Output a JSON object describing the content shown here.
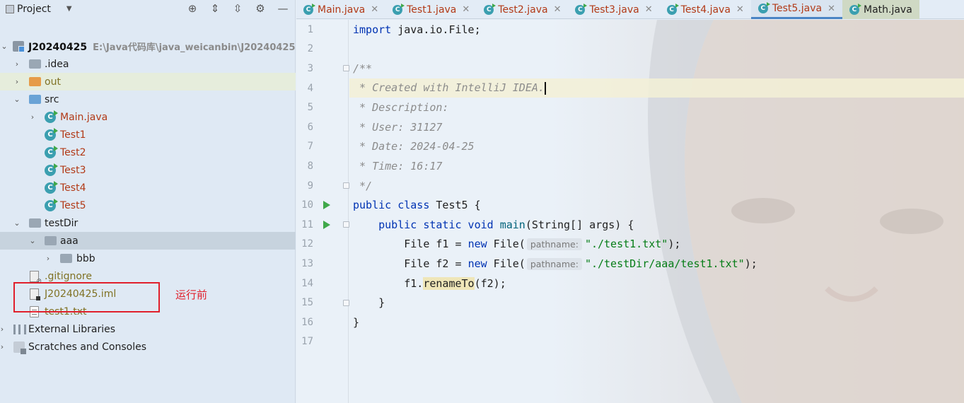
{
  "project_panel": {
    "title": "Project",
    "root": {
      "name": "J20240425",
      "path": "E:\\Java代码库\\java_weicanbin\\J20240425"
    },
    "items": [
      {
        "name": ".idea"
      },
      {
        "name": "out"
      },
      {
        "name": "src"
      },
      {
        "name": "Main.java"
      },
      {
        "name": "Test1"
      },
      {
        "name": "Test2"
      },
      {
        "name": "Test3"
      },
      {
        "name": "Test4"
      },
      {
        "name": "Test5"
      },
      {
        "name": "testDir"
      },
      {
        "name": "aaa"
      },
      {
        "name": "bbb"
      },
      {
        "name": ".gitignore"
      },
      {
        "name": "J20240425.iml"
      },
      {
        "name": "test1.txt"
      },
      {
        "name": "External Libraries"
      },
      {
        "name": "Scratches and Consoles"
      }
    ],
    "annotation": "运行前"
  },
  "tabs": [
    {
      "label": "Main.java"
    },
    {
      "label": "Test1.java"
    },
    {
      "label": "Test2.java"
    },
    {
      "label": "Test3.java"
    },
    {
      "label": "Test4.java"
    },
    {
      "label": "Test5.java"
    },
    {
      "label": "Math.java"
    }
  ],
  "icon_letter": "C",
  "editor": {
    "line_numbers": [
      "1",
      "2",
      "3",
      "4",
      "5",
      "6",
      "7",
      "8",
      "9",
      "10",
      "11",
      "12",
      "13",
      "14",
      "15",
      "16",
      "17"
    ],
    "code": {
      "l1_kw": "import",
      "l1_rest": " java.io.File;",
      "l3": "/**",
      "l4": " * Created with IntelliJ IDEA.",
      "l5": " * Description:",
      "l6": " * User: 31127",
      "l7": " * Date: 2024-04-25",
      "l8": " * Time: 16:17",
      "l9": " */",
      "l10_kw": "public class",
      "l10_rest": " Test5 {",
      "l11_indent": "    ",
      "l11_kw": "public static void",
      "l11_fn": "main",
      "l11_rest": "(String[] args) {",
      "l12_pre": "        File f1 = ",
      "l12_kw": "new",
      "l12_call": " File(",
      "l12_hint": "pathname:",
      "l12_str": "\"./test1.txt\"",
      "l12_end": ");",
      "l13_pre": "        File f2 = ",
      "l13_kw": "new",
      "l13_call": " File(",
      "l13_hint": "pathname:",
      "l13_str": "\"./testDir/aaa/test1.txt\"",
      "l13_end": ");",
      "l14_pre": "        f1.",
      "l14_fn": "renameTo",
      "l14_end": "(f2);",
      "l15": "    }",
      "l16": "}"
    }
  }
}
